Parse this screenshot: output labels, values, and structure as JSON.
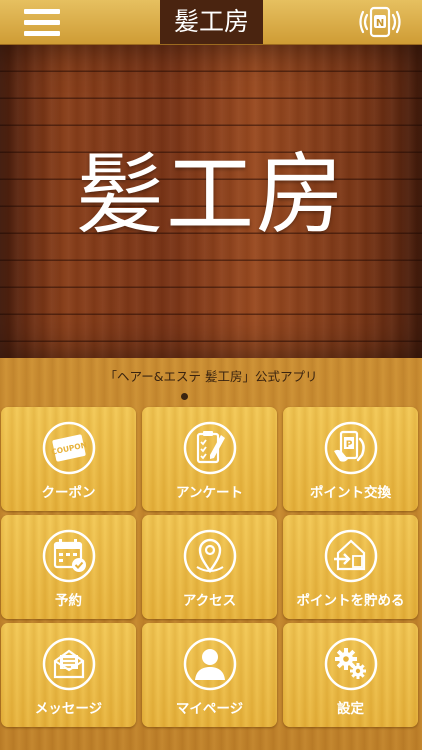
{
  "header": {
    "title": "髪工房",
    "menu_icon": "hamburger-menu-icon",
    "nfc_icon": "nfc-phone-icon"
  },
  "hero": {
    "title": "髪工房"
  },
  "subtitle": "「ヘアー&エステ 髪工房」公式アプリ",
  "tiles": [
    {
      "label": "クーポン",
      "icon": "coupon-icon"
    },
    {
      "label": "アンケート",
      "icon": "clipboard-checklist-icon"
    },
    {
      "label": "ポイント交換",
      "icon": "point-exchange-icon"
    },
    {
      "label": "予約",
      "icon": "calendar-check-icon"
    },
    {
      "label": "アクセス",
      "icon": "map-pin-icon"
    },
    {
      "label": "ポイントを貯める",
      "icon": "collect-points-icon"
    },
    {
      "label": "メッセージ",
      "icon": "message-icon"
    },
    {
      "label": "マイページ",
      "icon": "user-avatar-icon"
    },
    {
      "label": "設定",
      "icon": "settings-gears-icon"
    }
  ],
  "colors": {
    "header": "#dcae48",
    "title_box": "#4a2410",
    "tile": "#eebb45",
    "text_dark": "#3a2410"
  }
}
